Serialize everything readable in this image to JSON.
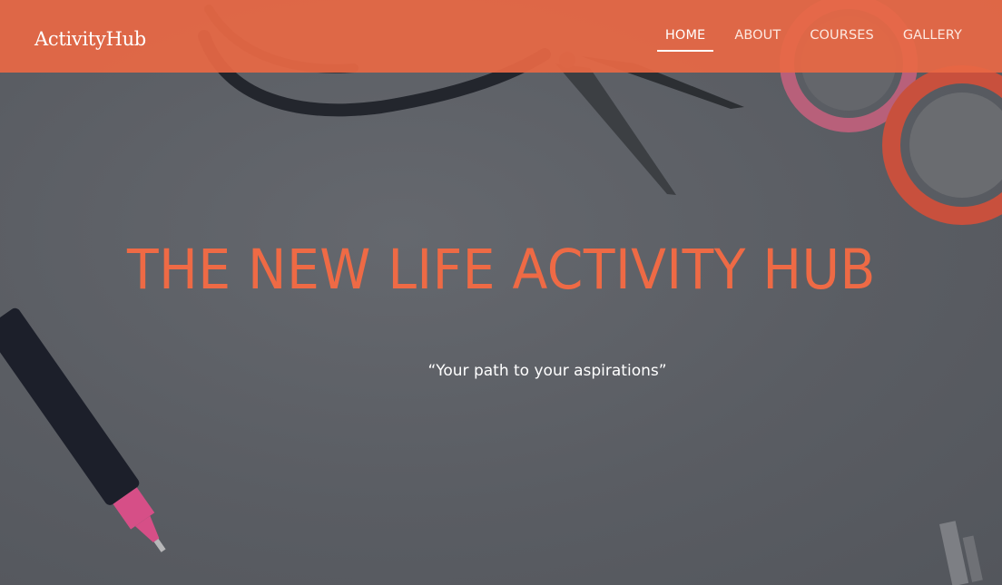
{
  "brand": {
    "name": "ActivityHub"
  },
  "nav": {
    "items": [
      {
        "label": "HOME",
        "active": true
      },
      {
        "label": "ABOUT",
        "active": false
      },
      {
        "label": "COURSES",
        "active": false
      },
      {
        "label": "GALLERY",
        "active": false
      }
    ]
  },
  "hero": {
    "title": "THE NEW LIFE ACTIVITY HUB",
    "tagline": "“Your path to your aspirations”"
  },
  "colors": {
    "accent": "#E86845",
    "title": "#EE6A45",
    "overlay": "#5A5D63"
  }
}
